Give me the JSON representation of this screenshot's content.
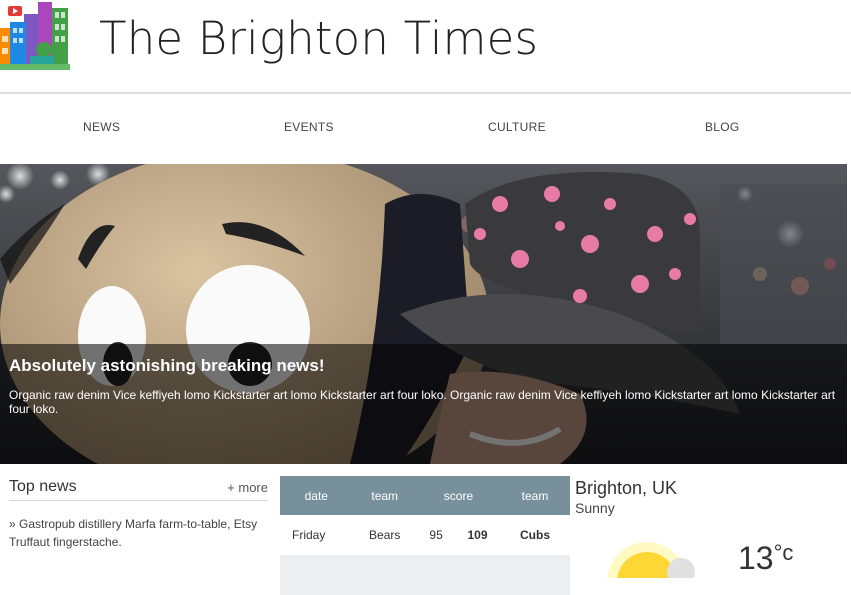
{
  "header": {
    "title": "The Brighton Times",
    "logo_icon": "city-logo-icon"
  },
  "nav": {
    "items": [
      "NEWS",
      "EVENTS",
      "CULTURE",
      "BLOG"
    ]
  },
  "hero": {
    "title": "Absolutely astonishing breaking news!",
    "text": "Organic raw denim Vice keffiyeh lomo Kickstarter art lomo Kickstarter art four loko. Organic raw denim Vice keffiyeh lomo Kickstarter art lomo Kickstarter art four loko."
  },
  "top_news": {
    "title": "Top news",
    "more_label": "+ more",
    "items": [
      "» Gastropub distillery Marfa farm-to-table, Etsy Truffaut fingerstache."
    ]
  },
  "scores": {
    "columns": [
      "date",
      "team",
      "score",
      "team"
    ],
    "rows": [
      {
        "date": "Friday",
        "team1": "Bears",
        "score1": "95",
        "score2": "109",
        "team2": "Cubs"
      },
      {
        "date": "",
        "team1": "",
        "score1": "",
        "score2": "",
        "team2": ""
      }
    ],
    "header_color": "#78909c"
  },
  "weather": {
    "city": "Brighton, UK",
    "condition": "Sunny",
    "temperature": "13",
    "unit": "°c",
    "icon": "sun-cloud-icon"
  }
}
